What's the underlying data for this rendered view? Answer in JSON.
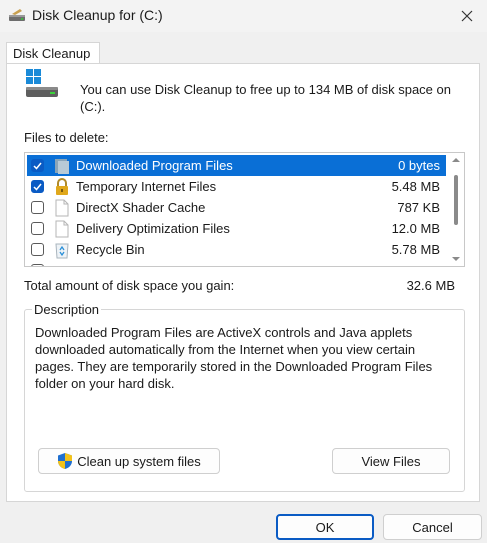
{
  "window": {
    "title": "Disk Cleanup for  (C:)"
  },
  "tab": {
    "label": "Disk Cleanup"
  },
  "intro": {
    "text": "You can use Disk Cleanup to free up to 134 MB of disk space on (C:)."
  },
  "files": {
    "label": "Files to delete:",
    "items": [
      {
        "name": "Downloaded Program Files",
        "size": "0 bytes",
        "checked": true,
        "selected": true,
        "icon": "folder-icon"
      },
      {
        "name": "Temporary Internet Files",
        "size": "5.48 MB",
        "checked": true,
        "selected": false,
        "icon": "lock-icon"
      },
      {
        "name": "DirectX Shader Cache",
        "size": "787 KB",
        "checked": false,
        "selected": false,
        "icon": "file-icon"
      },
      {
        "name": "Delivery Optimization Files",
        "size": "12.0 MB",
        "checked": false,
        "selected": false,
        "icon": "file-icon"
      },
      {
        "name": "Recycle Bin",
        "size": "5.78 MB",
        "checked": false,
        "selected": false,
        "icon": "recycle-bin-icon"
      }
    ]
  },
  "total": {
    "label": "Total amount of disk space you gain:",
    "value": "32.6 MB"
  },
  "description": {
    "legend": "Description",
    "text": "Downloaded Program Files are ActiveX controls and Java applets downloaded automatically from the Internet when you view certain pages. They are temporarily stored in the Downloaded Program Files folder on your hard disk."
  },
  "buttons": {
    "cleanup_system": "Clean up system files",
    "view_files": "View Files",
    "ok": "OK",
    "cancel": "Cancel"
  },
  "colors": {
    "selection": "#0a6fd6",
    "checkbox_checked": "#0a5bc4",
    "accent": "#0a5bc4"
  }
}
